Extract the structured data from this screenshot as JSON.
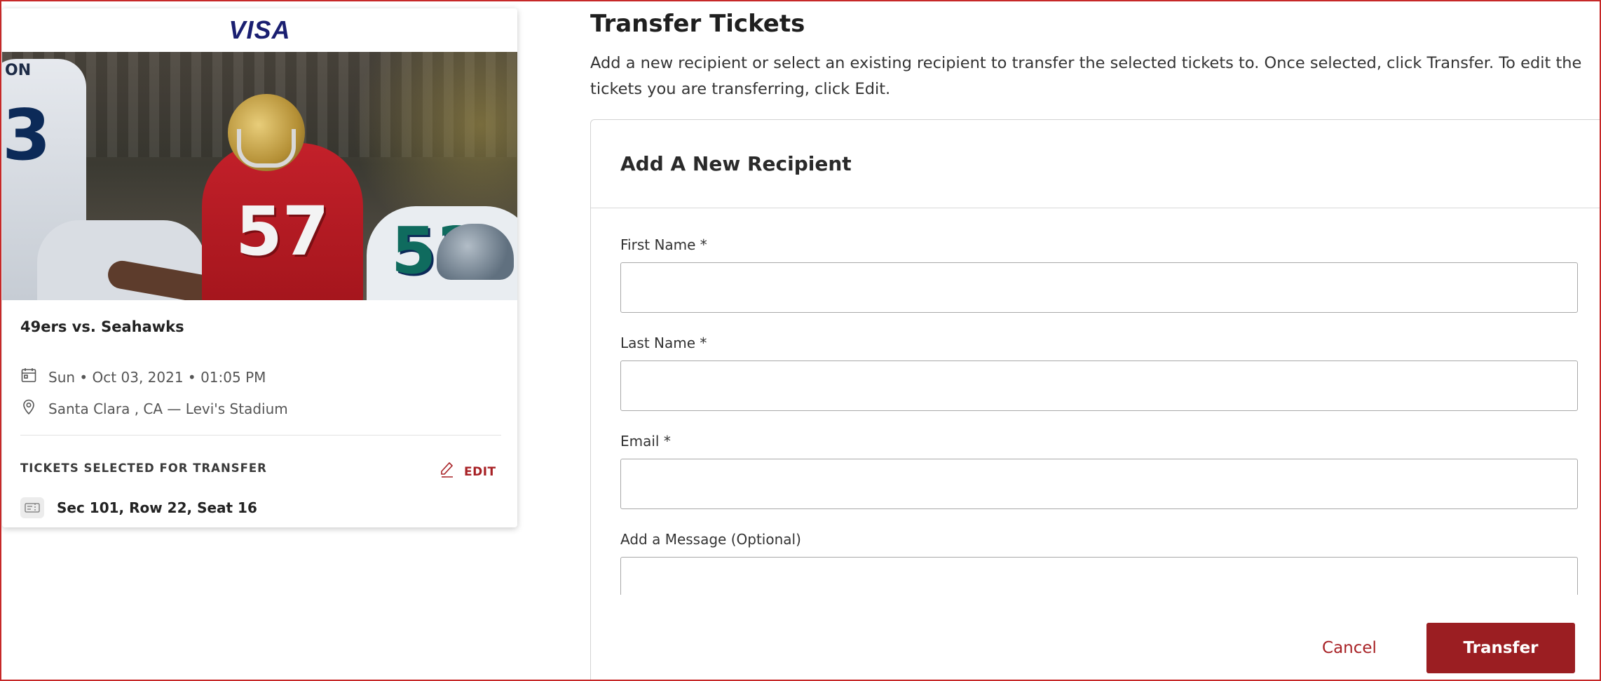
{
  "sponsor": {
    "name": "VISA"
  },
  "hero": {
    "left_player_name": "ON",
    "left_player_number": "3",
    "main_player_number": "57",
    "right_player_number": "53"
  },
  "event": {
    "name": "49ers vs. Seahawks",
    "datetime": "Sun • Oct 03, 2021 • 01:05 PM",
    "location": "Santa Clara , CA — Levi's Stadium"
  },
  "tickets": {
    "label": "TICKETS SELECTED FOR TRANSFER",
    "edit_label": "EDIT",
    "seat": "Sec 101, Row 22, Seat 16"
  },
  "panel": {
    "title": "Transfer Tickets",
    "description": "Add a new recipient or select an existing recipient to transfer the selected tickets to. Once selected, click Transfer. To edit the tickets you are transferring, click Edit."
  },
  "form": {
    "header": "Add A New Recipient",
    "first_name_label": "First Name *",
    "first_name_value": "",
    "last_name_label": "Last Name *",
    "last_name_value": "",
    "email_label": "Email *",
    "email_value": "",
    "message_label": "Add a Message (Optional)",
    "message_value": ""
  },
  "actions": {
    "cancel_label": "Cancel",
    "transfer_label": "Transfer"
  },
  "colors": {
    "accent": "#9b1e22",
    "accent_text": "#a82226",
    "visa_blue": "#1a1f71"
  }
}
